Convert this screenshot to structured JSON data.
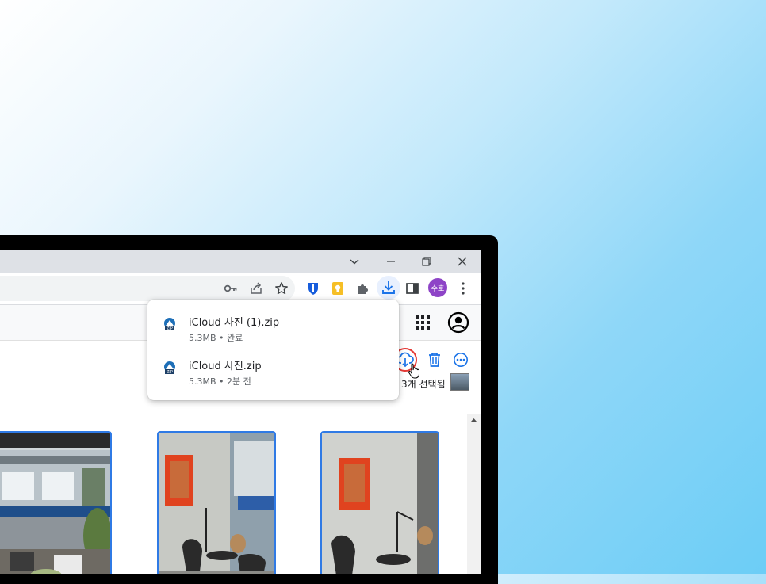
{
  "window": {
    "controls": {
      "dropdown": "⌄",
      "minimize": "—",
      "restore": "❐",
      "close": "✕"
    }
  },
  "toolbar": {
    "profile_initials": "수호"
  },
  "downloads": [
    {
      "name": "iCloud 사진 (1).zip",
      "meta": "5.3MB • 완료"
    },
    {
      "name": "iCloud 사진.zip",
      "meta": "5.3MB • 2분 전"
    }
  ],
  "selection": {
    "count_label": "3개 선택됨"
  },
  "icons": {
    "colors": {
      "bitwarden": "#175ddc",
      "keep": "#f6bf26",
      "download_active": "#1a73e8",
      "profile": "#8e44c7",
      "action_blue": "#1a73e8",
      "highlight_ring": "#e53935",
      "selection_border": "#2f7ae5"
    }
  }
}
